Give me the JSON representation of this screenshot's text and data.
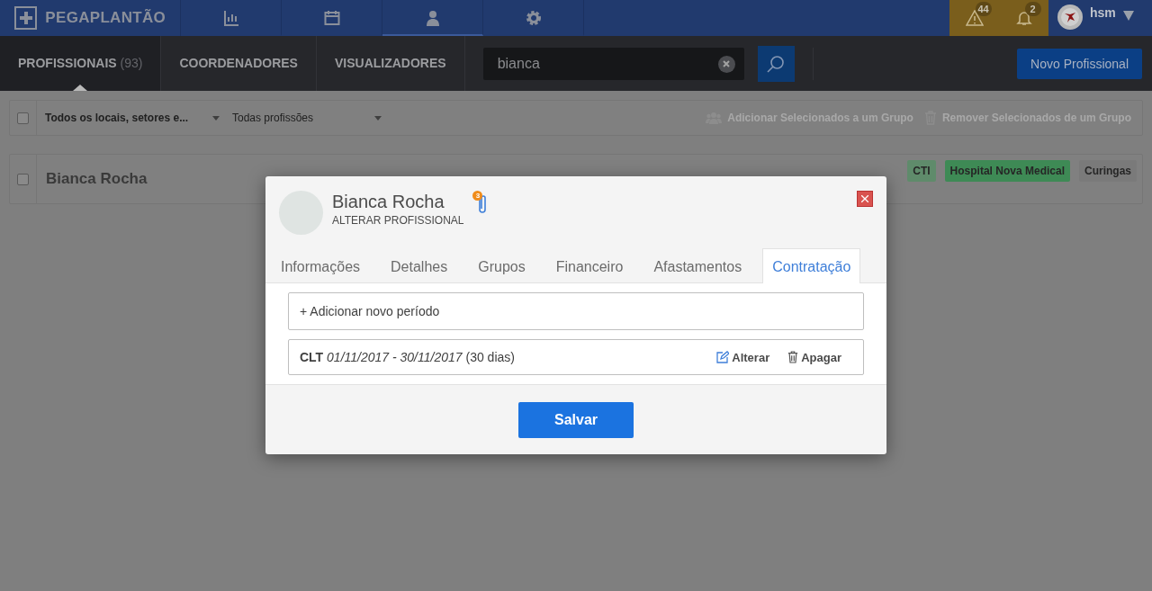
{
  "topbar": {
    "logo_text": "PEGAPLANTÃO",
    "nav_items": [
      {
        "kind": "chart",
        "selected": false
      },
      {
        "kind": "calendar",
        "selected": false
      },
      {
        "kind": "person",
        "selected": true
      },
      {
        "kind": "gear",
        "selected": false
      }
    ],
    "alerts": [
      {
        "kind": "warning",
        "count": "44"
      },
      {
        "kind": "bell",
        "count": "2"
      }
    ],
    "user": "hsm"
  },
  "subbar": {
    "tabs": [
      {
        "label": "PROFISSIONAIS",
        "count": "(93)",
        "selected": true
      },
      {
        "label": "COORDENADORES",
        "selected": false
      },
      {
        "label": "VISUALIZADORES",
        "selected": false
      }
    ],
    "search": {
      "value": "bianca"
    },
    "new_button": "Novo Profissional"
  },
  "filters": {
    "select_all": {
      "checked": false
    },
    "locations": "Todos os locais, setores e...",
    "profession": "Todas profissões",
    "actions": [
      {
        "kind": "group",
        "label": "Adicionar Selecionados a um Grupo"
      },
      {
        "kind": "trash",
        "label": "Remover Selecionados de um Grupo"
      }
    ]
  },
  "rows": [
    {
      "name": "Bianca Rocha",
      "checked": false,
      "tags": [
        {
          "label": "CTI",
          "color": "#5f8b6b"
        },
        {
          "label": "Hospital Nova Medical",
          "color": "#3e8a55"
        },
        {
          "label": "Curingas",
          "color": "#7a7a7a"
        }
      ]
    }
  ],
  "modal": {
    "name": "Bianca Rocha",
    "subtitle": "ALTERAR PROFISSIONAL",
    "attachments": "3",
    "tabs": [
      {
        "label": "Informações",
        "selected": false
      },
      {
        "label": "Detalhes",
        "selected": false
      },
      {
        "label": "Grupos",
        "selected": false
      },
      {
        "label": "Financeiro",
        "selected": false
      },
      {
        "label": "Afastamentos",
        "selected": false
      },
      {
        "label": "Contratação",
        "selected": true
      }
    ],
    "add_period": "+ Adicionar novo período",
    "periods": [
      {
        "text": "**CLT** *01/11/2017 - 30/11/2017* (30 dias)",
        "edit": "Alterar",
        "delete": "Apagar"
      }
    ],
    "save": "Salvar"
  }
}
